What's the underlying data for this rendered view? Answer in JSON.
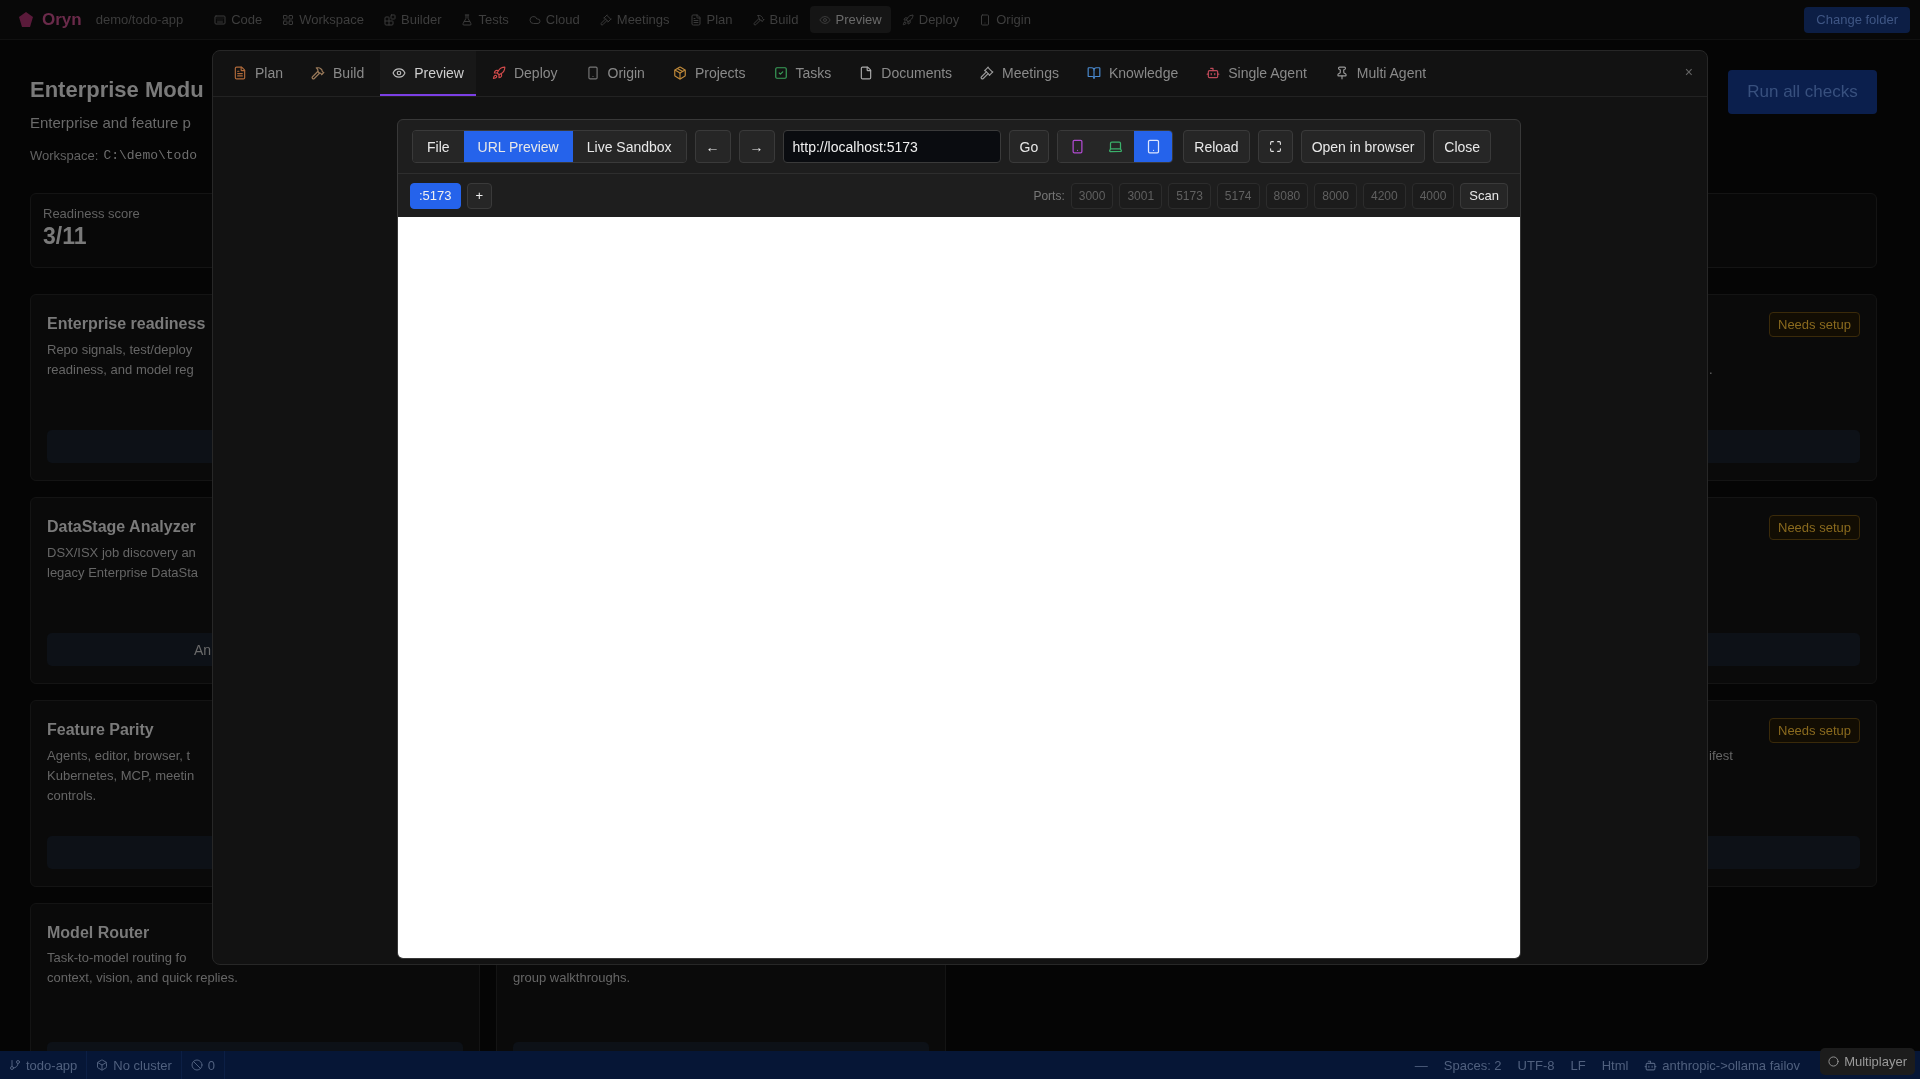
{
  "top_bar": {
    "app_name": "Oryn",
    "project": "demo/todo-app",
    "nav": [
      {
        "label": "Code",
        "selected": false
      },
      {
        "label": "Workspace",
        "selected": false
      },
      {
        "label": "Builder",
        "selected": false
      },
      {
        "label": "Tests",
        "selected": false
      },
      {
        "label": "Cloud",
        "selected": false
      },
      {
        "label": "Meetings",
        "selected": false
      },
      {
        "label": "Plan",
        "selected": false
      },
      {
        "label": "Build",
        "selected": false
      },
      {
        "label": "Preview",
        "selected": true
      },
      {
        "label": "Deploy",
        "selected": false
      },
      {
        "label": "Origin",
        "selected": false
      }
    ],
    "change_folder": "Change folder"
  },
  "page": {
    "title": "Enterprise Modu",
    "subtitle": "Enterprise and feature p",
    "workspace_label": "Workspace:",
    "workspace_path": "C:\\demo\\todo",
    "run_button": "Run all checks",
    "score": {
      "label": "Readiness score",
      "value": "3/11"
    },
    "modules": [
      {
        "title": "Enterprise readiness",
        "lines": [
          {
            "left": "Repo signals, test/deploy"
          },
          {
            "left": "readiness, and model reg",
            "right": "."
          }
        ],
        "badge": "Needs setup"
      },
      {
        "title": "DataStage Analyzer",
        "lines": [
          {
            "left": "DSX/ISX job discovery an"
          },
          {
            "left": "legacy Enterprise DataSta"
          }
        ],
        "badge": "Needs setup",
        "action": "An"
      },
      {
        "title": "Feature Parity",
        "lines": [
          {
            "left": "Agents, editor, browser, t",
            "right": "ifest"
          },
          {
            "left": "Kubernetes, MCP, meetin"
          },
          {
            "left": "controls."
          }
        ],
        "badge": "Needs setup"
      }
    ],
    "lower_cards": [
      {
        "title": "Model Router",
        "lines": [
          "Task-to-model routing fo",
          "context, vision, and quick replies."
        ]
      },
      {
        "lines": [
          "group walkthroughs."
        ]
      }
    ]
  },
  "modal": {
    "tabs": [
      {
        "label": "Plan",
        "selected": false
      },
      {
        "label": "Build",
        "selected": false
      },
      {
        "label": "Preview",
        "selected": true
      },
      {
        "label": "Deploy",
        "selected": false
      },
      {
        "label": "Origin",
        "selected": false
      },
      {
        "label": "Projects",
        "selected": false
      },
      {
        "label": "Tasks",
        "selected": false
      },
      {
        "label": "Documents",
        "selected": false
      },
      {
        "label": "Meetings",
        "selected": false
      },
      {
        "label": "Knowledge",
        "selected": false
      },
      {
        "label": "Single Agent",
        "selected": false
      },
      {
        "label": "Multi Agent",
        "selected": false
      }
    ],
    "close": "×",
    "preview": {
      "modes": [
        {
          "label": "File",
          "selected": false
        },
        {
          "label": "URL Preview",
          "selected": true
        },
        {
          "label": "Live Sandbox",
          "selected": false
        }
      ],
      "back": "←",
      "forward": "→",
      "url": "http://localhost:5173",
      "go": "Go",
      "devices": [
        {
          "kind": "phone",
          "selected": false
        },
        {
          "kind": "laptop",
          "selected": false
        },
        {
          "kind": "tablet",
          "selected": true
        }
      ],
      "reload": "Reload",
      "open_browser": "Open in browser",
      "close": "Close",
      "instances": [
        {
          "label": ":5173",
          "selected": true
        }
      ],
      "add": "+",
      "ports_label": "Ports:",
      "ports": [
        "3000",
        "3001",
        "5173",
        "5174",
        "8080",
        "8000",
        "4200",
        "4000"
      ],
      "scan": "Scan"
    }
  },
  "status_bar": {
    "branch": "todo-app",
    "cluster": "No cluster",
    "problems": "0",
    "right": [
      "—",
      "Spaces: 2",
      "UTF-8",
      "LF",
      "Html"
    ],
    "model": "anthropic->ollama failov",
    "multiplayer": "Multiplayer"
  }
}
